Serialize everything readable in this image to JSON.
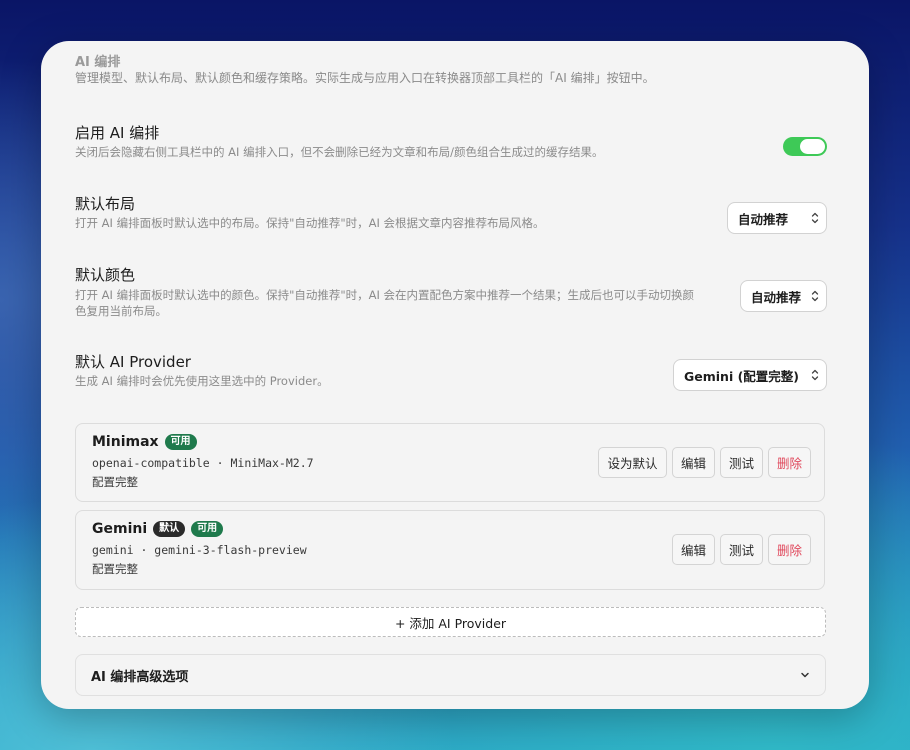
{
  "section": {
    "title": "AI 编排",
    "description": "管理模型、默认布局、默认颜色和缓存策略。实际生成与应用入口在转换器顶部工具栏的「AI 编排」按钮中。"
  },
  "enable_ai": {
    "title": "启用 AI 编排",
    "description": "关闭后会隐藏右侧工具栏中的 AI 编排入口，但不会删除已经为文章和布局/颜色组合生成过的缓存结果。",
    "enabled": true
  },
  "default_layout": {
    "title": "默认布局",
    "description": "打开 AI 编排面板时默认选中的布局。保持\"自动推荐\"时，AI 会根据文章内容推荐布局风格。",
    "value": "自动推荐"
  },
  "default_color": {
    "title": "默认颜色",
    "description_line1": "打开 AI 编排面板时默认选中的颜色。保持\"自动推荐\"时，AI 会在内置配色方案中推荐一个结果；生成后也可以手动切换颜",
    "description_line2": "色复用当前布局。",
    "value": "自动推荐"
  },
  "default_provider": {
    "title": "默认 AI Provider",
    "description": "生成 AI 编排时会优先使用这里选中的 Provider。",
    "value": "Gemini (配置完整)"
  },
  "providers": [
    {
      "name": "Minimax",
      "badges": [
        "可用"
      ],
      "meta": "openai-compatible · MiniMax-M2.7",
      "status": "配置完整",
      "actions": [
        "设为默认",
        "编辑",
        "测试",
        "删除"
      ]
    },
    {
      "name": "Gemini",
      "badges": [
        "默认",
        "可用"
      ],
      "meta": "gemini · gemini-3-flash-preview",
      "status": "配置完整",
      "actions": [
        "编辑",
        "测试",
        "删除"
      ]
    }
  ],
  "add_provider_label": "+ 添加 AI Provider",
  "advanced": {
    "label": "AI 编排高级选项"
  },
  "colors": {
    "toggle_on": "#3ec957",
    "badge_available": "#1f7a4c",
    "badge_default": "#2a2a2a",
    "danger": "#e0475b"
  },
  "icons": [
    "select-chevron-icon",
    "chevron-down-icon"
  ]
}
